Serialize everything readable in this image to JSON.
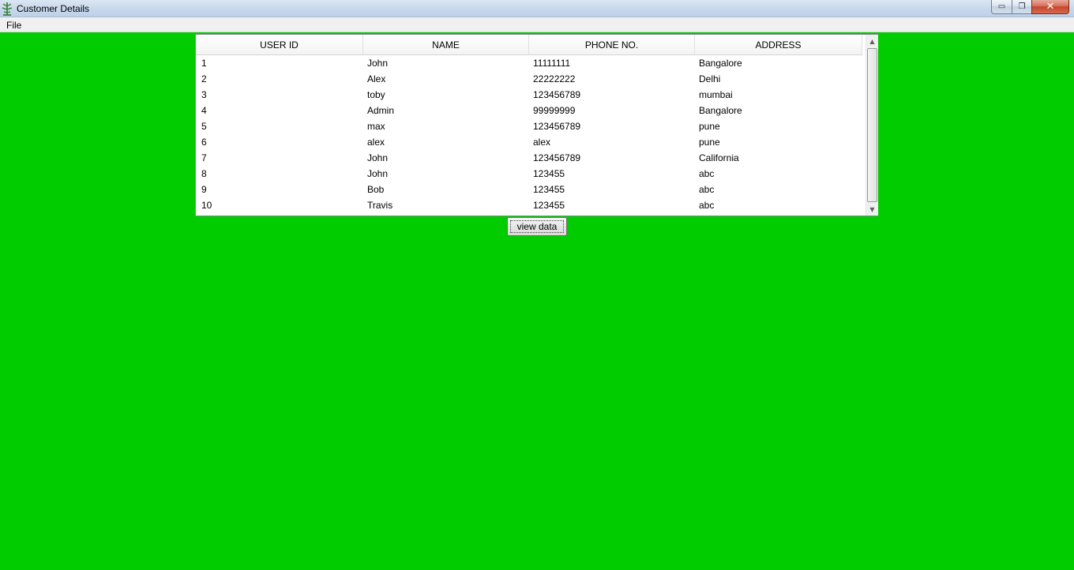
{
  "window": {
    "title": "Customer Details",
    "icon": "app-icon",
    "controls": {
      "minimize": "▭",
      "maximize": "❐",
      "close": "✕"
    }
  },
  "menubar": {
    "file_label": "File"
  },
  "table": {
    "columns": [
      "USER ID",
      "NAME",
      "PHONE NO.",
      "ADDRESS"
    ],
    "rows": [
      [
        "1",
        "John",
        "11111111",
        "Bangalore"
      ],
      [
        "2",
        "Alex",
        "22222222",
        "Delhi"
      ],
      [
        "3",
        "toby",
        "123456789",
        "mumbai"
      ],
      [
        "4",
        "Admin",
        "99999999",
        "Bangalore"
      ],
      [
        "5",
        "max",
        "123456789",
        "pune"
      ],
      [
        "6",
        "alex",
        "alex",
        "pune"
      ],
      [
        "7",
        "John",
        "123456789",
        "California"
      ],
      [
        "8",
        "John",
        "123455",
        "abc"
      ],
      [
        "9",
        "Bob",
        "123455",
        "abc"
      ],
      [
        "10",
        "Travis",
        "123455",
        "abc"
      ]
    ]
  },
  "scrollbar": {
    "up_arrow": "▲",
    "down_arrow": "▼"
  },
  "actions": {
    "view_data_label": "view data"
  },
  "colors": {
    "background": "#00cc00"
  }
}
